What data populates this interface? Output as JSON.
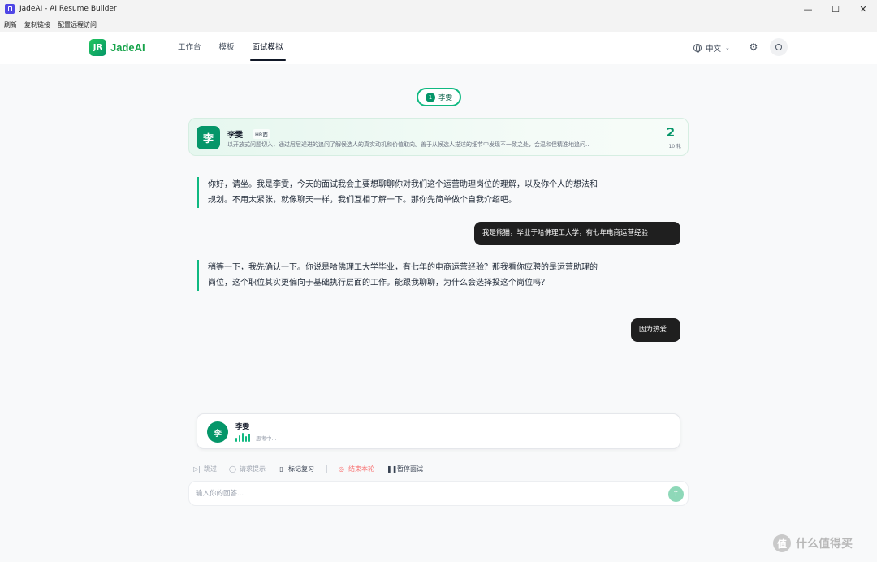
{
  "window": {
    "title": "JadeAI - AI Resume Builder",
    "minimize": "—",
    "maximize": "☐",
    "close": "✕"
  },
  "menubar": [
    "刷新",
    "复制链接",
    "配置远程访问"
  ],
  "navbar": {
    "logo_mark": "JR",
    "logo_text": "JadeAI",
    "tabs": [
      "工作台",
      "模板",
      "面试模拟"
    ],
    "active_tab": "面试模拟",
    "language": "中文"
  },
  "interviewer_pill": {
    "number": "1",
    "name": "李雯"
  },
  "interviewer_card": {
    "avatar": "李",
    "name": "李雯",
    "role": "HR面",
    "description": "以开放式问题切入，通过层层递进的追问了解候选人的真实动机和价值取向。善于从候选人描述的细节中发现不一致之处，会温和但精准地追问...",
    "count": "2",
    "count_label": "10 轮"
  },
  "messages": [
    {
      "role": "ai",
      "text": "你好，请坐。我是李雯，今天的面试我会主要想聊聊你对我们这个运营助理岗位的理解，以及你个人的想法和规划。不用太紧张，就像聊天一样，我们互相了解一下。那你先简单做个自我介绍吧。"
    },
    {
      "role": "user",
      "text": "我是熊猫，毕业于哈佛理工大学，有七年电商运营经验"
    },
    {
      "role": "ai",
      "text": "稍等一下，我先确认一下。你说是哈佛理工大学毕业，有七年的电商运营经验？那我看你应聘的是运营助理的岗位，这个职位其实更偏向于基础执行层面的工作。能跟我聊聊，为什么会选择投这个岗位吗？"
    },
    {
      "role": "user",
      "text": "因为热爱"
    }
  ],
  "thinking": {
    "avatar": "李",
    "name": "李雯",
    "status": "思考中..."
  },
  "actions": {
    "skip": "跳过",
    "hint": "请求提示",
    "bookmark": "标记复习",
    "end_round": "结束本轮",
    "pause": "暂停面试"
  },
  "composer": {
    "placeholder": "输入你的回答...",
    "send_icon": "↑"
  },
  "watermark": {
    "badge": "值",
    "text": "什么值得买"
  },
  "colors": {
    "accent": "#10b981",
    "accent_dark": "#059669",
    "user_bubble": "#1f1f1f",
    "danger": "#f87171"
  }
}
